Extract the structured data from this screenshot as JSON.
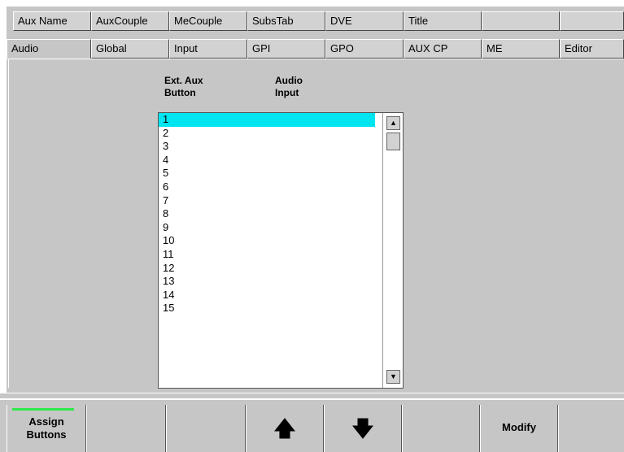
{
  "tabs_row1": [
    "Aux Name",
    "AuxCouple",
    "MeCouple",
    "SubsTab",
    "DVE",
    "Title",
    "",
    ""
  ],
  "tabs_row2": [
    "Audio",
    "Global",
    "Input",
    "GPI",
    "GPO",
    "AUX CP",
    "ME",
    "Editor"
  ],
  "table": {
    "col1_line1": "Ext. Aux",
    "col1_line2": "Button",
    "col2_line1": "Audio",
    "col2_line2": "Input",
    "rows": [
      "1",
      "2",
      "3",
      "4",
      "5",
      "6",
      "7",
      "8",
      "9",
      "10",
      "11",
      "12",
      "13",
      "14",
      "15"
    ],
    "selected_row": "1"
  },
  "scrollbar": {
    "up_icon": "triangle-up",
    "down_icon": "triangle-down"
  },
  "bottom_buttons": {
    "assign_line1": "Assign",
    "assign_line2": "Buttons",
    "up_arrow": "up-arrow-icon",
    "down_arrow": "down-arrow-icon",
    "modify": "Modify"
  },
  "colors": {
    "selection": "#00e5f0",
    "panel": "#c6c6c6",
    "active_indicator": "#2ee84a"
  }
}
